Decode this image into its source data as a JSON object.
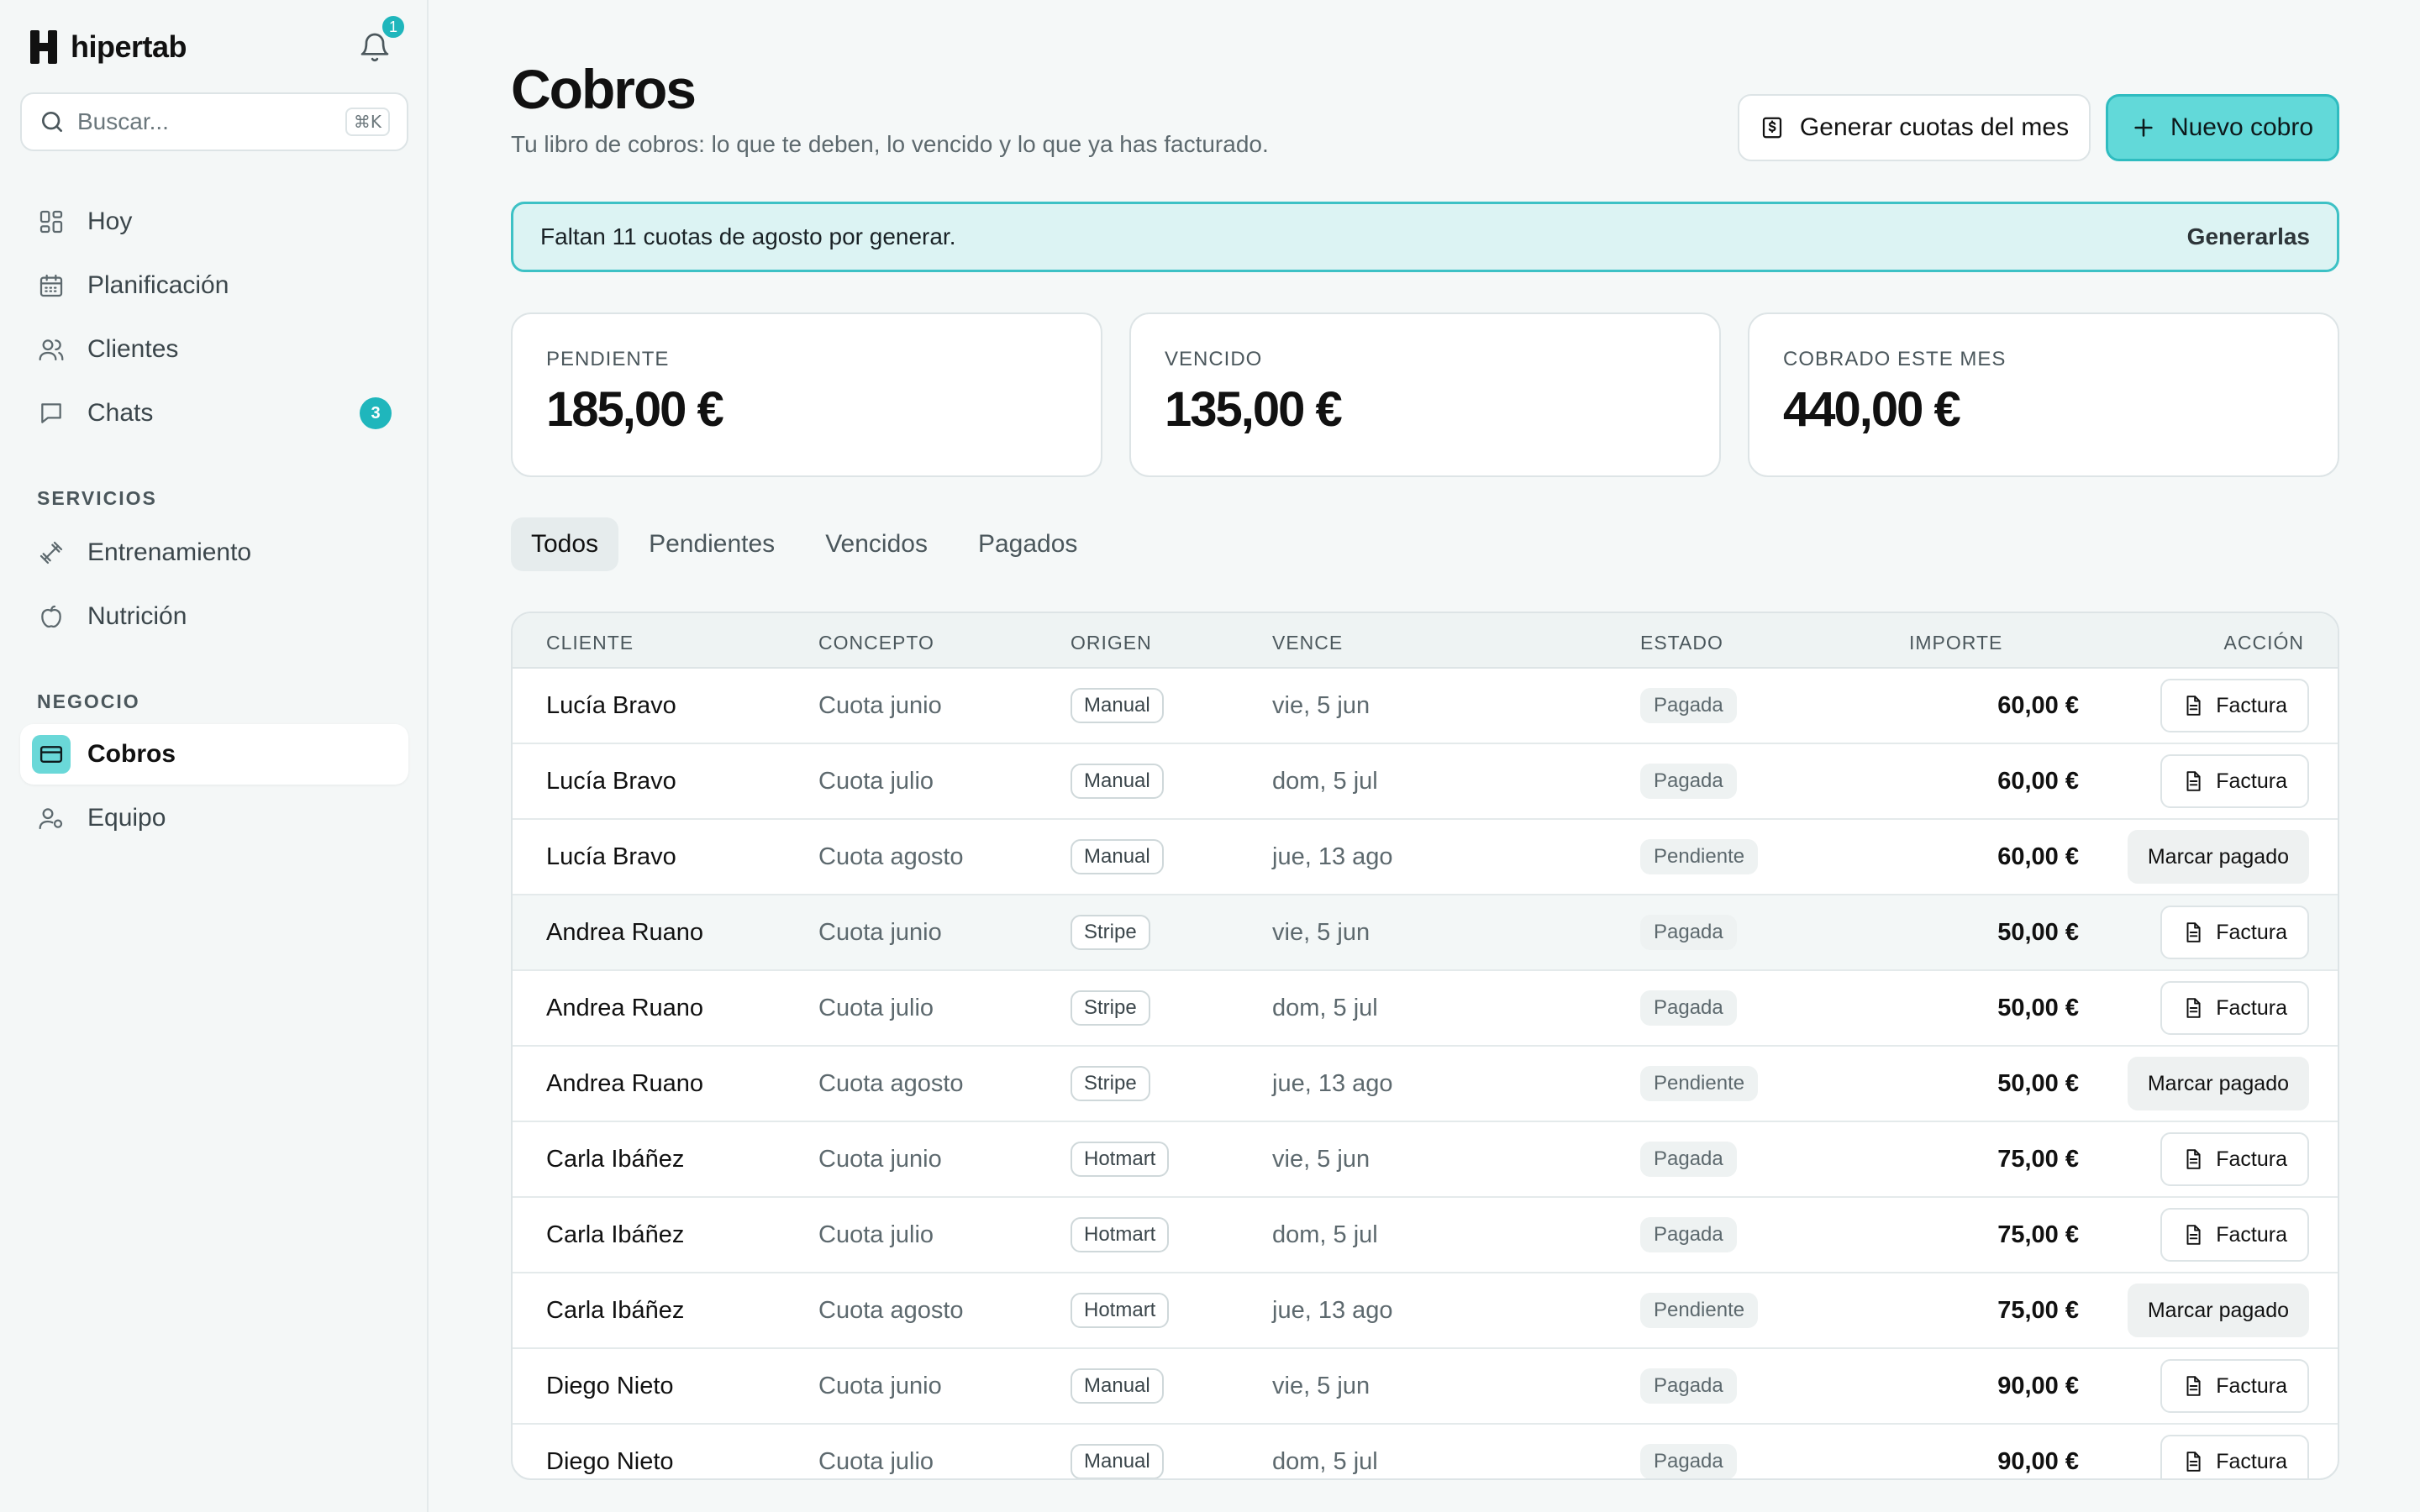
{
  "brand": {
    "name": "hipertab"
  },
  "notifications": {
    "count": "1"
  },
  "search": {
    "placeholder": "Buscar...",
    "shortcut": "⌘K"
  },
  "nav": {
    "main": [
      {
        "label": "Hoy",
        "icon": "grid-icon"
      },
      {
        "label": "Planificación",
        "icon": "calendar-icon"
      },
      {
        "label": "Clientes",
        "icon": "users-icon"
      },
      {
        "label": "Chats",
        "icon": "chat-icon",
        "badge": "3"
      }
    ],
    "servicios_label": "SERVICIOS",
    "servicios": [
      {
        "label": "Entrenamiento",
        "icon": "dumbbell-icon"
      },
      {
        "label": "Nutrición",
        "icon": "apple-icon"
      }
    ],
    "negocio_label": "NEGOCIO",
    "negocio": [
      {
        "label": "Cobros",
        "icon": "card-icon",
        "active": true
      },
      {
        "label": "Equipo",
        "icon": "team-icon"
      }
    ]
  },
  "header": {
    "title": "Cobros",
    "subtitle": "Tu libro de cobros: lo que te deben, lo vencido y lo que ya has facturado.",
    "generate_label": "Generar cuotas del mes",
    "new_label": "Nuevo cobro"
  },
  "banner": {
    "text": "Faltan 11 cuotas de agosto por generar.",
    "action": "Generarlas"
  },
  "stats": [
    {
      "label": "PENDIENTE",
      "value": "185,00 €"
    },
    {
      "label": "VENCIDO",
      "value": "135,00 €"
    },
    {
      "label": "COBRADO ESTE MES",
      "value": "440,00 €"
    }
  ],
  "tabs": [
    "Todos",
    "Pendientes",
    "Vencidos",
    "Pagados"
  ],
  "table": {
    "headers": {
      "client": "CLIENTE",
      "concept": "CONCEPTO",
      "origin": "ORIGEN",
      "due": "VENCE",
      "status": "ESTADO",
      "amount": "IMPORTE",
      "action": "ACCIÓN"
    },
    "rows": [
      {
        "client": "Lucía Bravo",
        "concept": "Cuota junio",
        "origin": "Manual",
        "due": "vie, 5 jun",
        "status": "Pagada",
        "amount": "60,00 €",
        "action": "Factura"
      },
      {
        "client": "Lucía Bravo",
        "concept": "Cuota julio",
        "origin": "Manual",
        "due": "dom, 5 jul",
        "status": "Pagada",
        "amount": "60,00 €",
        "action": "Factura"
      },
      {
        "client": "Lucía Bravo",
        "concept": "Cuota agosto",
        "origin": "Manual",
        "due": "jue, 13 ago",
        "status": "Pendiente",
        "amount": "60,00 €",
        "action": "Marcar pagado"
      },
      {
        "client": "Andrea Ruano",
        "concept": "Cuota junio",
        "origin": "Stripe",
        "due": "vie, 5 jun",
        "status": "Pagada",
        "amount": "50,00 €",
        "action": "Factura"
      },
      {
        "client": "Andrea Ruano",
        "concept": "Cuota julio",
        "origin": "Stripe",
        "due": "dom, 5 jul",
        "status": "Pagada",
        "amount": "50,00 €",
        "action": "Factura"
      },
      {
        "client": "Andrea Ruano",
        "concept": "Cuota agosto",
        "origin": "Stripe",
        "due": "jue, 13 ago",
        "status": "Pendiente",
        "amount": "50,00 €",
        "action": "Marcar pagado"
      },
      {
        "client": "Carla Ibáñez",
        "concept": "Cuota junio",
        "origin": "Hotmart",
        "due": "vie, 5 jun",
        "status": "Pagada",
        "amount": "75,00 €",
        "action": "Factura"
      },
      {
        "client": "Carla Ibáñez",
        "concept": "Cuota julio",
        "origin": "Hotmart",
        "due": "dom, 5 jul",
        "status": "Pagada",
        "amount": "75,00 €",
        "action": "Factura"
      },
      {
        "client": "Carla Ibáñez",
        "concept": "Cuota agosto",
        "origin": "Hotmart",
        "due": "jue, 13 ago",
        "status": "Pendiente",
        "amount": "75,00 €",
        "action": "Marcar pagado"
      },
      {
        "client": "Diego Nieto",
        "concept": "Cuota junio",
        "origin": "Manual",
        "due": "vie, 5 jun",
        "status": "Pagada",
        "amount": "90,00 €",
        "action": "Factura"
      },
      {
        "client": "Diego Nieto",
        "concept": "Cuota julio",
        "origin": "Manual",
        "due": "dom, 5 jul",
        "status": "Pagada",
        "amount": "90,00 €",
        "action": "Factura"
      }
    ]
  },
  "colors": {
    "accent": "#1fb6bc",
    "accent_light": "#62d9d9",
    "banner_bg": "#dcf3f3"
  }
}
